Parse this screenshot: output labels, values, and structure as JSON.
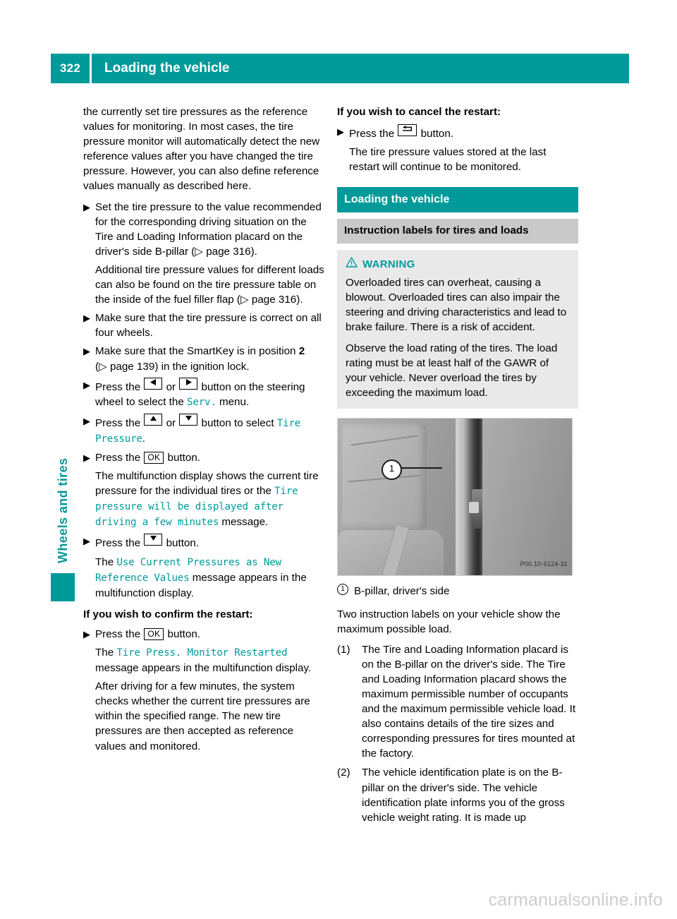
{
  "header": {
    "page_number": "322",
    "title": "Loading the vehicle"
  },
  "side_tab": {
    "label": "Wheels and tires"
  },
  "colors": {
    "accent_teal": "#009a9a",
    "gray_bar": "#c9c9c9",
    "warning_bg": "#e9e9e9",
    "watermark": "#cdcdcd"
  },
  "left_column": {
    "intro_paragraph": "the currently set tire pressures as the reference values for monitoring. In most cases, the tire pressure monitor will automatically detect the new reference values after you have changed the tire pressure. However, you can also define reference values manually as described here.",
    "step1": {
      "text": "Set the tire pressure to the value recommended for the corresponding driving situation on the Tire and Loading Information placard on the driver's side B-pillar (",
      "ref": "page 316",
      "tail": ").",
      "note": "Additional tire pressure values for different loads can also be found on the tire pressure table on the inside of the fuel filler flap (",
      "note_ref": "page 316",
      "note_tail": ")."
    },
    "step2": {
      "text": "Make sure that the tire pressure is correct on all four wheels."
    },
    "step3": {
      "pre": "Make sure that the SmartKey is in position ",
      "bold_value": "2",
      "mid": " (",
      "ref": "page 139",
      "tail": ") in the ignition lock."
    },
    "step4": {
      "pre": "Press the ",
      "mid": " or ",
      "post": " button on the steering wheel to select the ",
      "menu": "Serv.",
      "tail": " menu."
    },
    "step5": {
      "pre": "Press the ",
      "mid": " or ",
      "post": " button to select ",
      "menu": "Tire Pressure",
      "tail": "."
    },
    "step6": {
      "pre": "Press the ",
      "key": "OK",
      "post": " button.",
      "result_pre": "The multifunction display shows the current tire pressure for the individual tires or the ",
      "result_msg": "Tire pressure will be displayed after driving a few minutes",
      "result_tail": " message."
    },
    "step7": {
      "pre": "Press the ",
      "post": " button.",
      "result_pre": "The ",
      "result_msg": "Use Current Pressures as New Reference Values",
      "result_tail": " message appears in the multifunction display."
    },
    "confirm_heading": "If you wish to confirm the restart:",
    "step8": {
      "pre": "Press the ",
      "key": "OK",
      "post": " button.",
      "result_pre": "The ",
      "result_msg": "Tire Press. Monitor Restarted",
      "result_tail": " message appears in the multifunction display.",
      "note": "After driving for a few minutes, the system checks whether the current tire pressures are within the specified range. The new tire pressures are then accepted as reference values and monitored."
    }
  },
  "right_column": {
    "cancel_heading": "If you wish to cancel the restart:",
    "cancel_step": {
      "pre": "Press the ",
      "post": " button.",
      "result": "The tire pressure values stored at the last restart will continue to be monitored."
    },
    "section_bar": "Loading the vehicle",
    "subsection_bar": "Instruction labels for tires and loads",
    "warning": {
      "label": "WARNING",
      "paragraph_1": "Overloaded tires can overheat, causing a blowout. Overloaded tires can also impair the steering and driving characteristics and lead to brake failure. There is a risk of accident.",
      "paragraph_2": "Observe the load rating of the tires. The load rating must be at least half of the GAWR of your vehicle. Never overload the tires by exceeding the maximum load."
    },
    "figure": {
      "callout_number": "1",
      "code": "P00.10-5124-31",
      "legend_marker": "1",
      "legend_text": "B-pillar, driver's side"
    },
    "body_paragraph": "Two instruction labels on your vehicle show the maximum possible load.",
    "numbered_items": [
      {
        "marker": "(1)",
        "text": "The Tire and Loading Information placard is on the B-pillar on the driver's side. The Tire and Loading Information placard shows the maximum permissible number of occupants and the maximum permissible vehicle load. It also contains details of the tire sizes and corresponding pressures for tires mounted at the factory."
      },
      {
        "marker": "(2)",
        "text": "The vehicle identification plate is on the B-pillar on the driver's side. The vehicle identification plate informs you of the gross vehicle weight rating. It is made up"
      }
    ]
  },
  "footer": {
    "watermark": "carmanualsonline.info"
  }
}
